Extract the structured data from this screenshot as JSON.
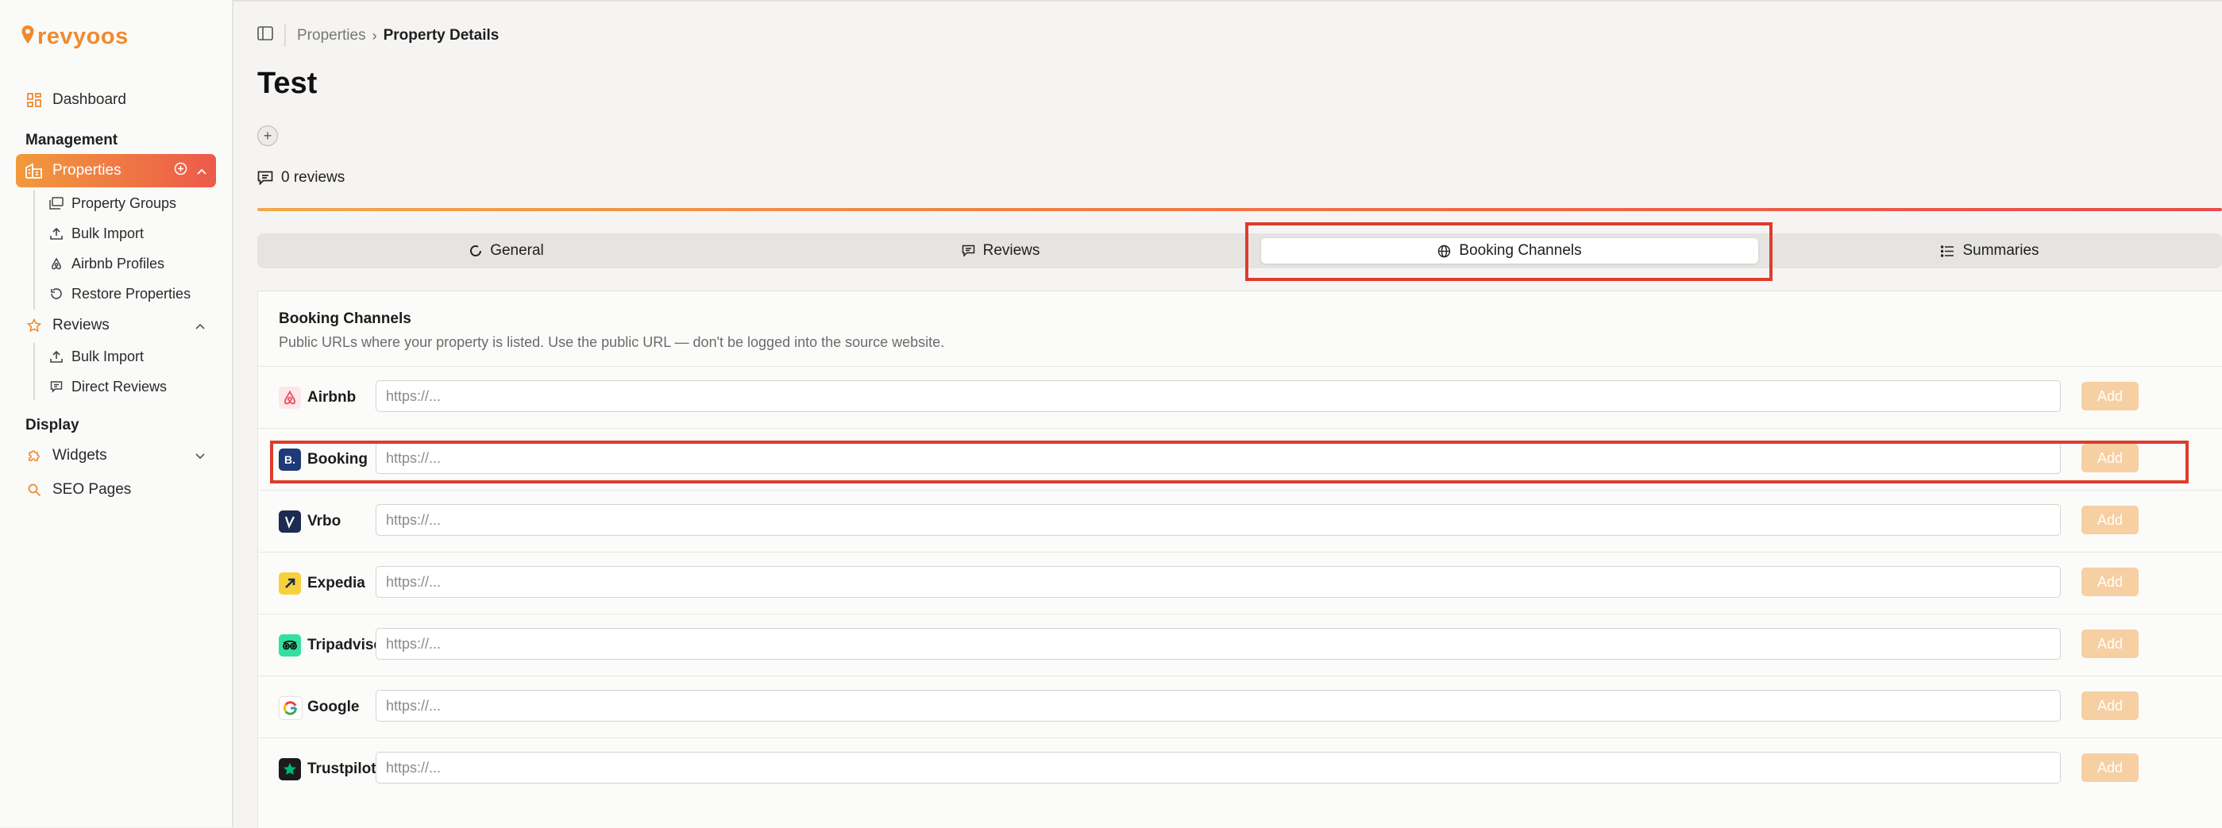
{
  "app": {
    "logo_text": "revyoos",
    "brand_color": "#f08a2e"
  },
  "sidebar": {
    "dashboard": "Dashboard",
    "management_label": "Management",
    "properties": "Properties",
    "properties_children": [
      "Property Groups",
      "Bulk Import",
      "Airbnb Profiles",
      "Restore Properties"
    ],
    "reviews": "Reviews",
    "reviews_children": [
      "Bulk Import",
      "Direct Reviews"
    ],
    "display_label": "Display",
    "widgets": "Widgets",
    "seo_pages": "SEO Pages"
  },
  "breadcrumb": {
    "parent": "Properties",
    "current": "Property Details"
  },
  "page": {
    "title": "Test",
    "reviews_count": "0 reviews"
  },
  "tabs": [
    {
      "label": "General",
      "icon": "loader-icon"
    },
    {
      "label": "Reviews",
      "icon": "message-icon"
    },
    {
      "label": "Booking Channels",
      "icon": "globe-icon",
      "selected": true
    },
    {
      "label": "Summaries",
      "icon": "list-icon"
    }
  ],
  "booking": {
    "title": "Booking Channels",
    "description": "Public URLs where your property is listed. Use the public URL — don't be logged into the source website.",
    "placeholder": "https://...",
    "add_label": "Add",
    "channels": [
      {
        "name": "Airbnb",
        "color": "#e8505b"
      },
      {
        "name": "Booking",
        "color": "#1e3a78"
      },
      {
        "name": "Vrbo",
        "color": "#1d2b52"
      },
      {
        "name": "Expedia",
        "color": "#f7d13c"
      },
      {
        "name": "Tripadvisor",
        "color": "#34e0a1"
      },
      {
        "name": "Google",
        "color": "#4285f4"
      },
      {
        "name": "Trustpilot",
        "color": "#00b67a"
      }
    ]
  },
  "colors": {
    "accent_start": "#f29a3c",
    "accent_end": "#ec5a4a",
    "highlight": "#dc3d2b"
  }
}
